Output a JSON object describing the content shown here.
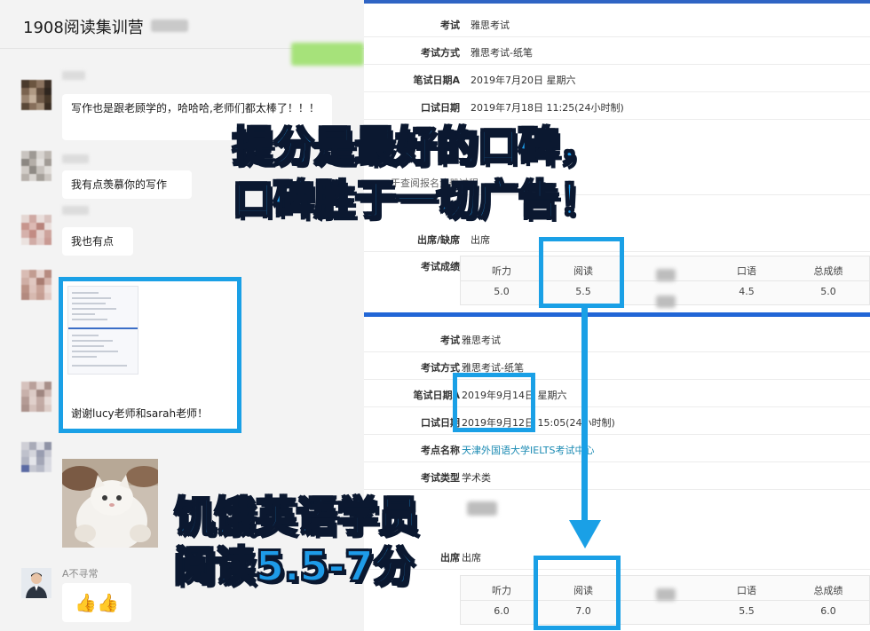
{
  "chat": {
    "title": "1908阅读集训营",
    "messages": [
      {
        "text": "写作也是跟老顾学的，哈哈哈,老师们都太棒了！！！"
      },
      {
        "text": "我有点羡慕你的写作"
      },
      {
        "text": "我也有点"
      },
      {
        "text": "谢谢lucy老师和sarah老师！"
      }
    ],
    "last_sender": "A不寻常",
    "last_message": "👍👍"
  },
  "report1": {
    "rows": [
      {
        "label": "考试",
        "value": "雅思考试"
      },
      {
        "label": "考试方式",
        "value": "雅思考试-纸笔"
      },
      {
        "label": "笔试日期A",
        "value": "2019年7月20日 星期六"
      },
      {
        "label": "口试日期",
        "value": "2019年7月18日 11:25(24小时制)"
      }
    ],
    "partial_text": "于查阅报名注册过程",
    "attendance": {
      "label": "出席/缺席",
      "value": "出席"
    },
    "scores_label": "考试成绩",
    "scores": [
      {
        "name": "听力",
        "value": "5.0"
      },
      {
        "name": "阅读",
        "value": "5.5"
      },
      {
        "name": "口语",
        "value": "4.5"
      },
      {
        "name": "总成绩",
        "value": "5.0"
      }
    ]
  },
  "report2": {
    "rows": [
      {
        "label": "考试",
        "value": "雅思考试"
      },
      {
        "label": "考试方式",
        "value": "雅思考试-纸笔"
      },
      {
        "label": "笔试日期A",
        "value": "2019年9月14日 星期六"
      },
      {
        "label": "口试日期",
        "value": "2019年9月12日 15:05(24小时制)"
      },
      {
        "label": "考点名称",
        "value": "天津外国语大学IELTS考试中心"
      },
      {
        "label": "考试类型",
        "value": "学术类"
      }
    ],
    "attendance": {
      "label": "出席",
      "value": "出席"
    },
    "scores": [
      {
        "name": "听力",
        "value": "6.0"
      },
      {
        "name": "阅读",
        "value": "7.0"
      },
      {
        "name": "口语",
        "value": "5.5"
      },
      {
        "name": "总成绩",
        "value": "6.0"
      }
    ]
  },
  "overlay": {
    "headline_line1": "提分是最好的口碑，",
    "headline_line2": "口碑胜于一切广告！",
    "caption_line1": "饥饿英语学员",
    "caption_line2": "阅读5.5-7分"
  },
  "colors": {
    "accent_blue": "#1aa0e6",
    "report_bar": "#2166d6",
    "promo_fill": "#1e9be8"
  }
}
